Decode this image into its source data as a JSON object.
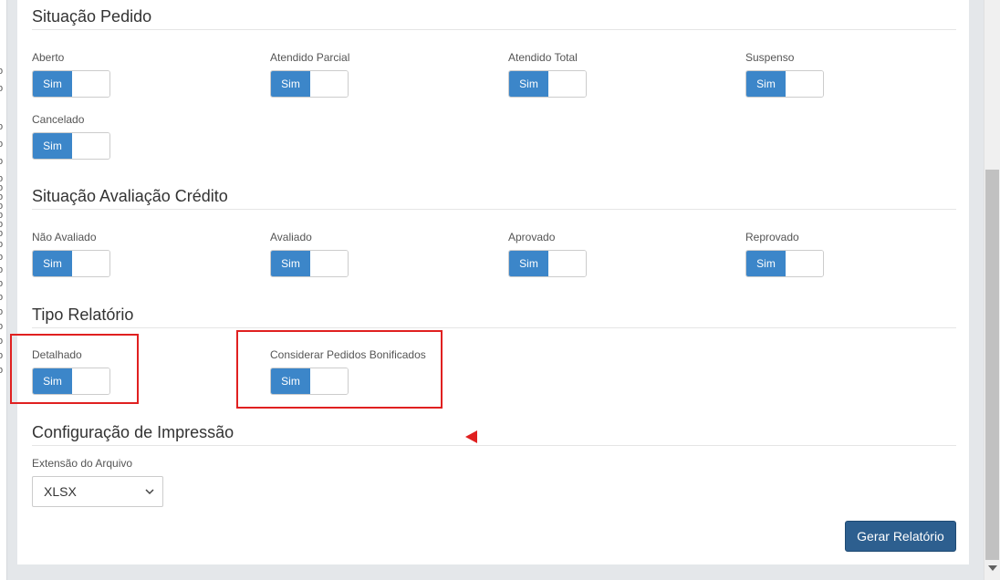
{
  "sections": {
    "situacao_pedido": {
      "title": "Situação Pedido",
      "fields": [
        {
          "label": "Aberto",
          "value": "Sim"
        },
        {
          "label": "Atendido Parcial",
          "value": "Sim"
        },
        {
          "label": "Atendido Total",
          "value": "Sim"
        },
        {
          "label": "Suspenso",
          "value": "Sim"
        },
        {
          "label": "Cancelado",
          "value": "Sim"
        }
      ]
    },
    "situacao_avaliacao": {
      "title": "Situação Avaliação Crédito",
      "fields": [
        {
          "label": "Não Avaliado",
          "value": "Sim"
        },
        {
          "label": "Avaliado",
          "value": "Sim"
        },
        {
          "label": "Aprovado",
          "value": "Sim"
        },
        {
          "label": "Reprovado",
          "value": "Sim"
        }
      ]
    },
    "tipo_relatorio": {
      "title": "Tipo Relatório",
      "fields": [
        {
          "label": "Detalhado",
          "value": "Sim"
        },
        {
          "label": "Considerar Pedidos Bonificados",
          "value": "Sim"
        }
      ]
    },
    "configuracao_impressao": {
      "title": "Configuração de Impressão",
      "extensao_label": "Extensão do Arquivo",
      "extensao_value": "XLSX"
    }
  },
  "actions": {
    "gerar_label": "Gerar Relatório"
  },
  "left_edge_glyphs": [
    "o",
    "o",
    "o",
    "o",
    "o",
    "o",
    "o",
    "o",
    "o",
    "o",
    "o",
    "o",
    "o",
    "o",
    "o",
    "o",
    "o",
    "o",
    "o",
    "o",
    "o",
    "o"
  ],
  "colors": {
    "toggle_on": "#3c86c9",
    "primary_button": "#2d5f8f",
    "highlight": "#e02020"
  },
  "icons": {
    "select_arrow": "chevron-down-icon",
    "annotation": "red-arrow-icon"
  }
}
